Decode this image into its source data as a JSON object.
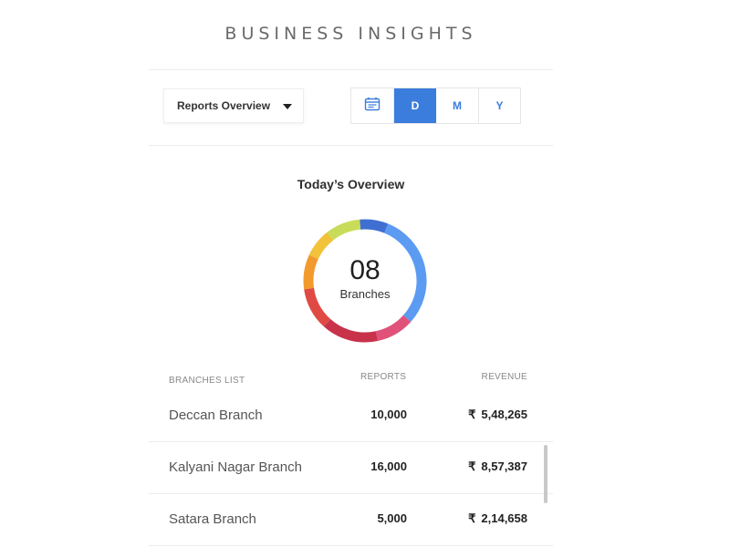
{
  "header": {
    "title": "BUSINESS INSIGHTS"
  },
  "toolbar": {
    "report_select": {
      "selected": "Reports Overview"
    },
    "calendar_icon": "calendar-icon",
    "periods": [
      {
        "label": "D",
        "active": true
      },
      {
        "label": "M",
        "active": false
      },
      {
        "label": "Y",
        "active": false
      }
    ],
    "accent_color": "#3b7ddd"
  },
  "overview": {
    "title": "Today’s Overview",
    "count": "08",
    "count_label": "Branches",
    "segment_colors": [
      "#3f6fd1",
      "#5b9bf2",
      "#e0527a",
      "#c8324a",
      "#e04a45",
      "#f29a2e",
      "#f2c23a",
      "#c9dc5a"
    ]
  },
  "branches": {
    "headers": {
      "name": "BRANCHES LIST",
      "reports": "REPORTS",
      "revenue": "REVENUE"
    },
    "currency_symbol": "₹",
    "rows": [
      {
        "name": "Deccan Branch",
        "reports": "10,000",
        "revenue": "5,48,265"
      },
      {
        "name": "Kalyani Nagar Branch",
        "reports": "16,000",
        "revenue": "8,57,387"
      },
      {
        "name": "Satara Branch",
        "reports": "5,000",
        "revenue": "2,14,658"
      }
    ]
  }
}
